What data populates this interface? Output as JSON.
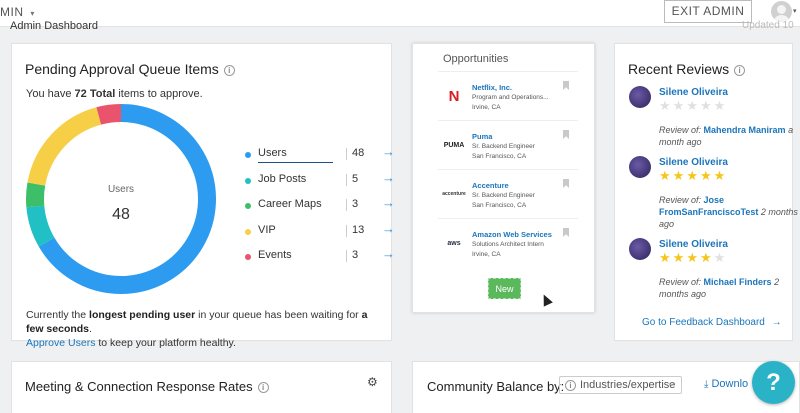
{
  "topbar": {
    "admin_menu": "MIN",
    "admin_caret": "▾",
    "exit_label": "EXIT ADMIN",
    "avatar_caret": "▾"
  },
  "page": {
    "breadcrumb": "Admin Dashboard",
    "updated": "Updated 10"
  },
  "pending": {
    "title": "Pending Approval Queue Items",
    "subtitle_pre": "You have ",
    "subtitle_total": "72 Total",
    "subtitle_post": " items to approve.",
    "center_label": "Users",
    "center_value": "48",
    "items": [
      {
        "label": "Users",
        "count": "48",
        "color": "#2d9cf0"
      },
      {
        "label": "Job Posts",
        "count": "5",
        "color": "#20c0c4"
      },
      {
        "label": "Career Maps",
        "count": "3",
        "color": "#3dbf6a"
      },
      {
        "label": "VIP",
        "count": "13",
        "color": "#f6cf47"
      },
      {
        "label": "Events",
        "count": "3",
        "color": "#e9536c"
      }
    ],
    "footer_1": "Currently the ",
    "footer_bold_1": "longest pending user",
    "footer_2": " in your queue has been waiting for ",
    "footer_bold_2": "a few seconds",
    "footer_3": ".",
    "footer_link": "Approve Users",
    "footer_4": " to keep your platform healthy."
  },
  "opportunities": {
    "heading": "Opportunities",
    "items": [
      {
        "name": "Netflix, Inc.",
        "line2": "Program and Operations...",
        "line3": "Irvine, CA",
        "logo_text": "N",
        "logo_color": "#d81f26"
      },
      {
        "name": "Puma",
        "line2": "Sr. Backend Engineer",
        "line3": "San Francisco, CA",
        "logo_text": "PUMA",
        "logo_color": "#222222"
      },
      {
        "name": "Accenture",
        "line2": "Sr. Backend Engineer",
        "line3": "San Francisco, CA",
        "logo_text": "accenture",
        "logo_color": "#333333"
      },
      {
        "name": "Amazon Web Services",
        "line2": "Solutions Architect Intern",
        "line3": "Irvine, CA",
        "logo_text": "aws",
        "logo_color": "#232f3e"
      }
    ],
    "new_label": "New"
  },
  "reviews": {
    "title": "Recent Reviews",
    "review_of_label": "Review of: ",
    "items": [
      {
        "name": "Silene Oliveira",
        "stars": 0,
        "subject": "Mahendra Maniram",
        "time": "a month ago"
      },
      {
        "name": "Silene Oliveira",
        "stars": 5,
        "subject": "Jose FromSanFranciscoTest",
        "time": "2 months ago"
      },
      {
        "name": "Silene Oliveira",
        "stars": 4,
        "subject": "Michael Finders",
        "time": "2 months ago"
      }
    ],
    "link": "Go to Feedback Dashboard",
    "link_arrow": "→"
  },
  "meeting": {
    "title": "Meeting & Connection Response Rates"
  },
  "community": {
    "title": "Community Balance by:",
    "select_value": "Industries/expertise",
    "download": "Downlo"
  },
  "help": {
    "label": "?"
  },
  "icons": {
    "info": "i",
    "arrow": "→",
    "gear": "⚙",
    "caret": "⌄"
  }
}
